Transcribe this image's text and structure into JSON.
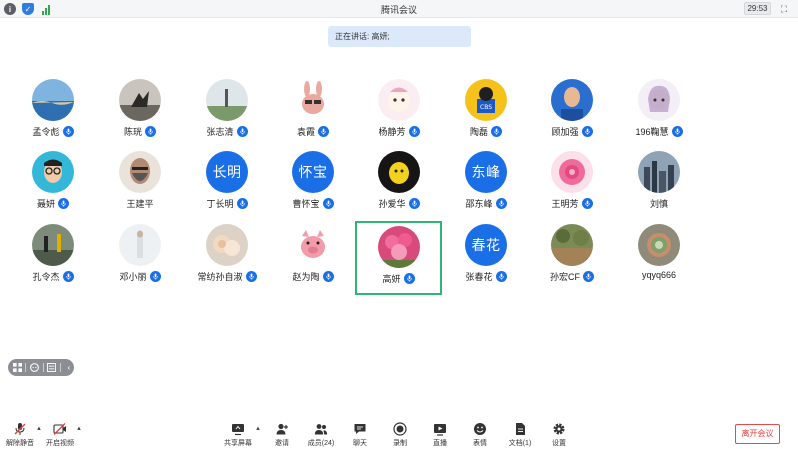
{
  "window": {
    "title": "腾讯会议",
    "timer": "29:53",
    "icons": [
      "info-icon",
      "shield-icon",
      "signal-icon",
      "fullscreen-icon"
    ]
  },
  "speaker_banner": {
    "text": "正在讲话: 高妍;"
  },
  "participants": [
    {
      "name": "孟令彪",
      "avatar_text": "",
      "avatar_type": "photo-sea",
      "mic": true
    },
    {
      "name": "陈珖",
      "avatar_text": "",
      "avatar_type": "photo-silhouette",
      "mic": true
    },
    {
      "name": "张志清",
      "avatar_text": "",
      "avatar_type": "photo-tower",
      "mic": true
    },
    {
      "name": "袁霞",
      "avatar_text": "",
      "avatar_type": "photo-rabbit",
      "mic": true
    },
    {
      "name": "杨静芳",
      "avatar_text": "",
      "avatar_type": "photo-cartoon",
      "mic": true
    },
    {
      "name": "陶磊",
      "avatar_text": "",
      "avatar_type": "photo-doll",
      "mic": true
    },
    {
      "name": "顾加强",
      "avatar_text": "",
      "avatar_type": "photo-man",
      "mic": true
    },
    {
      "name": "196鞠慧",
      "avatar_text": "",
      "avatar_type": "photo-girl",
      "mic": true
    },
    {
      "name": "聂妍",
      "avatar_text": "",
      "avatar_type": "photo-glasses",
      "mic": true
    },
    {
      "name": "王建平",
      "avatar_text": "",
      "avatar_type": "photo-beard",
      "mic": false
    },
    {
      "name": "丁长明",
      "avatar_text": "长明",
      "avatar_type": "text",
      "mic": true
    },
    {
      "name": "曹怀宝",
      "avatar_text": "怀宝",
      "avatar_type": "text",
      "mic": true
    },
    {
      "name": "孙爱华",
      "avatar_text": "",
      "avatar_type": "photo-yellow",
      "mic": true
    },
    {
      "name": "邵东峰",
      "avatar_text": "东峰",
      "avatar_type": "text",
      "mic": true
    },
    {
      "name": "王明芳",
      "avatar_text": "",
      "avatar_type": "photo-flower-pink",
      "mic": true
    },
    {
      "name": "刘慎",
      "avatar_text": "",
      "avatar_type": "photo-city",
      "mic": false
    },
    {
      "name": "孔令杰",
      "avatar_text": "",
      "avatar_type": "photo-basketball",
      "mic": true
    },
    {
      "name": "邓小丽",
      "avatar_text": "",
      "avatar_type": "photo-white",
      "mic": true
    },
    {
      "name": "常纺孙自淑",
      "avatar_text": "",
      "avatar_type": "photo-rose",
      "mic": true
    },
    {
      "name": "赵为陶",
      "avatar_text": "",
      "avatar_type": "photo-pig",
      "mic": true
    },
    {
      "name": "高妍",
      "avatar_text": "",
      "avatar_type": "photo-bouquet",
      "mic": true,
      "speaking": true
    },
    {
      "name": "张春花",
      "avatar_text": "春花",
      "avatar_type": "text",
      "mic": true
    },
    {
      "name": "孙宏CF",
      "avatar_text": "",
      "avatar_type": "photo-field",
      "mic": true
    },
    {
      "name": "yqyq666",
      "avatar_text": "",
      "avatar_type": "photo-succulent",
      "mic": false
    }
  ],
  "float_toolbar": {
    "icons": [
      "grid-view-icon",
      "chat-bubble-icon",
      "list-icon",
      "collapse-arrow-icon"
    ]
  },
  "toolbar": {
    "unmute": "解除静音",
    "start_video": "开启视频",
    "share_screen": "共享屏幕",
    "invite": "邀请",
    "members": "成员(24)",
    "chat": "聊天",
    "record": "录制",
    "live": "直播",
    "reactions": "表情",
    "documents": "文档(1)",
    "settings": "设置",
    "leave": "离开会议"
  },
  "colors": {
    "accent": "#1a6fe6",
    "speaking_border": "#2fb574",
    "leave": "#e03d3d",
    "banner": "#dbe9fb"
  }
}
